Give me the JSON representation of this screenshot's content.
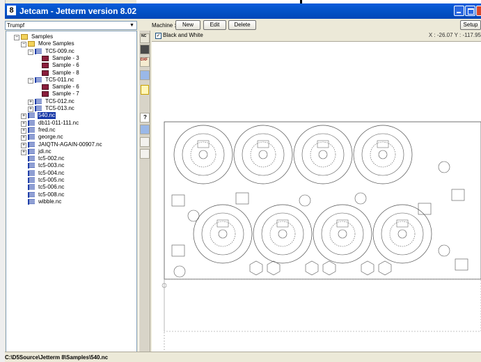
{
  "window": {
    "title": "Jetcam - Jetterm version 8.02",
    "app_badge": "8"
  },
  "machine_combo": {
    "value": "Trumpf"
  },
  "toolbar": {
    "machine_label": "Machine :",
    "new_label": "New",
    "edit_label": "Edit",
    "delete_label": "Delete",
    "setup_label": "Setup"
  },
  "options": {
    "bw_label": "Black and White",
    "checked_mark": "✓",
    "coords": "X : -26.07  Y : -117.95"
  },
  "tree": [
    {
      "label": "Samples",
      "icon": "folder-icon",
      "expander": "−"
    },
    {
      "label": "More Samples",
      "icon": "folder-icon",
      "expander": "−"
    },
    {
      "label": "TC5-009.nc",
      "icon": "nc-file-icon",
      "expander": "−"
    },
    {
      "label": "Sample - 3",
      "icon": "sample-sheet-icon",
      "expander": ""
    },
    {
      "label": "Sample - 6",
      "icon": "sample-sheet-icon",
      "expander": ""
    },
    {
      "label": "Sample - 8",
      "icon": "sample-sheet-icon",
      "expander": ""
    },
    {
      "label": "TC5-011.nc",
      "icon": "nc-file-icon",
      "expander": "−"
    },
    {
      "label": "Sample - 6",
      "icon": "sample-sheet-icon",
      "expander": ""
    },
    {
      "label": "Sample - 7",
      "icon": "sample-sheet-icon",
      "expander": ""
    },
    {
      "label": "TC5-012.nc",
      "icon": "nc-file-icon",
      "expander": "+"
    },
    {
      "label": "TC5-013.nc",
      "icon": "nc-file-icon",
      "expander": "+"
    },
    {
      "label": "540.nc",
      "icon": "nc-file-icon",
      "expander": "+",
      "selected": true
    },
    {
      "label": "db11-011-111.nc",
      "icon": "nc-file-icon",
      "expander": "+"
    },
    {
      "label": "fred.nc",
      "icon": "nc-file-icon",
      "expander": "+"
    },
    {
      "label": "george.nc",
      "icon": "nc-file-icon",
      "expander": "+"
    },
    {
      "label": "JAIQTN-AGAIN-00907.nc",
      "icon": "nc-file-icon",
      "expander": "+"
    },
    {
      "label": "jdi.nc",
      "icon": "nc-file-icon",
      "expander": "+"
    },
    {
      "label": "tc5-002.nc",
      "icon": "nc-file-icon",
      "expander": ""
    },
    {
      "label": "tc5-003.nc",
      "icon": "nc-file-icon",
      "expander": ""
    },
    {
      "label": "tc5-004.nc",
      "icon": "nc-file-icon",
      "expander": ""
    },
    {
      "label": "tc5-005.nc",
      "icon": "nc-file-icon",
      "expander": ""
    },
    {
      "label": "tc5-006.nc",
      "icon": "nc-file-icon",
      "expander": ""
    },
    {
      "label": "tc5-008.nc",
      "icon": "nc-file-icon",
      "expander": ""
    },
    {
      "label": "wibble.nc",
      "icon": "nc-file-icon",
      "expander": ""
    }
  ],
  "status": {
    "path": "C:\\D5Source\\Jetterm 8\\Samples\\540.nc"
  },
  "colors": {
    "titlebar": "#0453c8",
    "selection": "#1a3aa8",
    "part_line": "#505050"
  }
}
